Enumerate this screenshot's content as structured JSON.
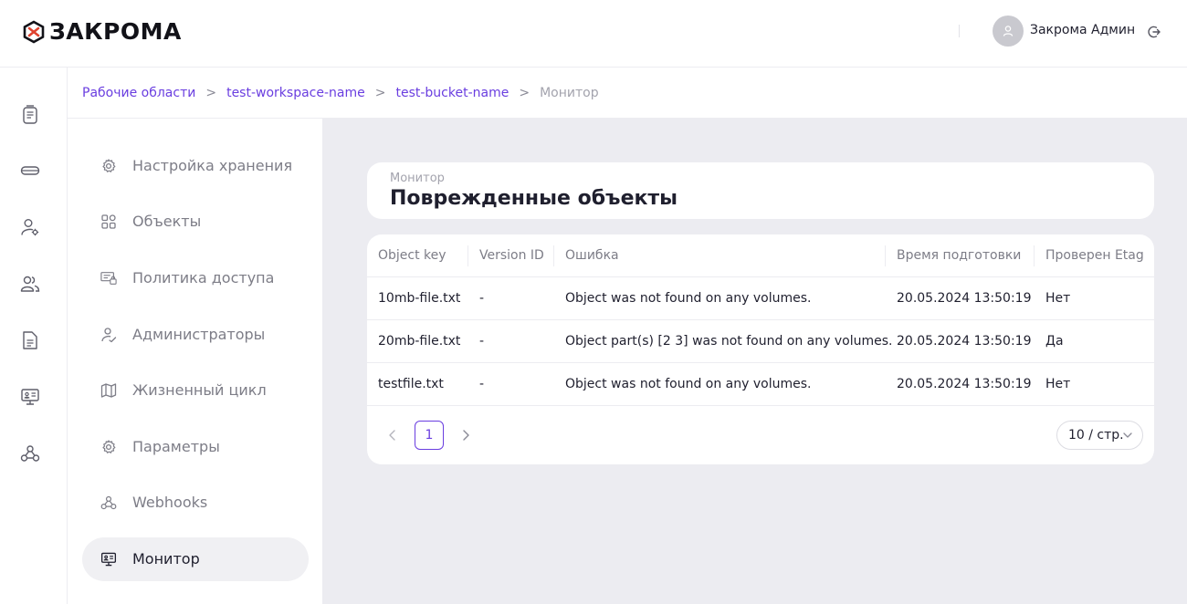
{
  "header": {
    "logo_text": "ЗАКРОМА",
    "user_name": "Закрома Админ",
    "icons": [
      "logo-mark-icon",
      "user-icon",
      "logout-icon"
    ]
  },
  "rail": {
    "icons": [
      "documents-icon",
      "storage-icon",
      "user-settings-icon",
      "users-icon",
      "file-icon",
      "monitor-icon",
      "webhooks-icon"
    ]
  },
  "breadcrumb": {
    "items": [
      "Рабочие области",
      "test-workspace-name",
      "test-bucket-name",
      "Монитор"
    ],
    "separator": ">"
  },
  "menu": {
    "items": [
      {
        "label": "Настройка хранения",
        "icon": "gear-icon"
      },
      {
        "label": "Объекты",
        "icon": "objects-icon"
      },
      {
        "label": "Политика доступа",
        "icon": "access-policy-icon"
      },
      {
        "label": "Администраторы",
        "icon": "admin-icon"
      },
      {
        "label": "Жизненный цикл",
        "icon": "map-icon"
      },
      {
        "label": "Параметры",
        "icon": "gear-icon"
      },
      {
        "label": "Webhooks",
        "icon": "webhooks-icon"
      },
      {
        "label": "Монитор",
        "icon": "monitor-icon"
      }
    ],
    "active": "Монитор"
  },
  "page": {
    "overline": "Монитор",
    "title": "Поврежденные объекты"
  },
  "table": {
    "columns": [
      "Object key",
      "Version ID",
      "Ошибка",
      "Время подготовки",
      "Проверен Etag"
    ],
    "rows": [
      [
        "10mb-file.txt",
        "-",
        "Object was not found on any volumes.",
        "20.05.2024 13:50:19",
        "Нет"
      ],
      [
        "20mb-file.txt",
        "-",
        "Object part(s) [2 3] was not found on any volumes.",
        "20.05.2024 13:50:19",
        "Да"
      ],
      [
        "testfile.txt",
        "-",
        "Object was not found on any volumes.",
        "20.05.2024 13:50:19",
        "Нет"
      ]
    ]
  },
  "pagination": {
    "current_page": "1",
    "page_size": "10 / стр."
  },
  "colors": {
    "accent": "#6a3ee0",
    "logo_red": "#e0432f",
    "background": "#ececf1"
  }
}
